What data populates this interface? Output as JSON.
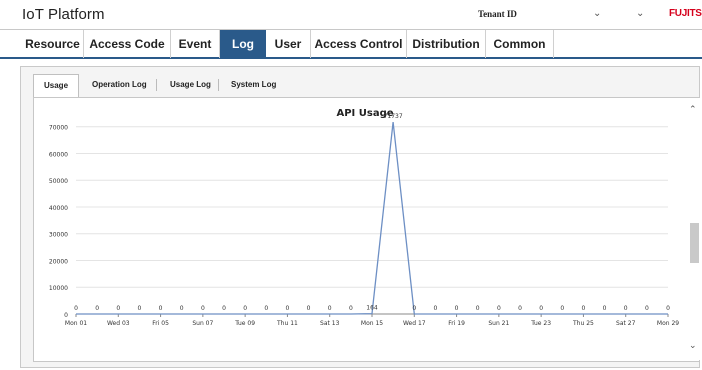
{
  "header": {
    "app_title": "IoT Platform",
    "tenant_label": "Tenant ID",
    "tenant_dropdown_arrow": "⌄",
    "second_dropdown_arrow": "⌄",
    "brand": "FUJITSU"
  },
  "nav": {
    "tabs": [
      {
        "label": "Resource"
      },
      {
        "label": "Access Code"
      },
      {
        "label": "Event"
      },
      {
        "label": "Log"
      },
      {
        "label": "User"
      },
      {
        "label": "Access Control"
      },
      {
        "label": "Distribution"
      },
      {
        "label": "Common"
      }
    ],
    "active": "Log"
  },
  "subtabs": {
    "tabs": [
      {
        "label": "Usage"
      },
      {
        "label": "Operation Log"
      },
      {
        "label": "Usage Log"
      },
      {
        "label": "System Log"
      }
    ],
    "active": "Usage"
  },
  "scrollbar": {
    "up_arrow": "⌃",
    "down_arrow": "⌄"
  },
  "chart_data": {
    "type": "line",
    "title": "API Usage",
    "xlabel": "",
    "ylabel": "",
    "ylim": [
      0,
      77000
    ],
    "yticks": [
      0,
      10000,
      20000,
      30000,
      40000,
      50000,
      60000,
      70000
    ],
    "x_tick_labels": [
      "Mon 01",
      "Wed 03",
      "Fri 05",
      "Sun 07",
      "Tue 09",
      "Thu 11",
      "Sat 13",
      "Mon 15",
      "Wed 17",
      "Fri 19",
      "Sun 21",
      "Tue 23",
      "Thu 25",
      "Sat 27",
      "Mon 29"
    ],
    "days": [
      1,
      2,
      3,
      4,
      5,
      6,
      7,
      8,
      9,
      10,
      11,
      12,
      13,
      14,
      15,
      16,
      17,
      18,
      19,
      20,
      21,
      22,
      23,
      24,
      25,
      26,
      27,
      28,
      29
    ],
    "values": [
      0,
      0,
      0,
      0,
      0,
      0,
      0,
      0,
      0,
      0,
      0,
      0,
      0,
      0,
      164,
      71737,
      0,
      0,
      0,
      0,
      0,
      0,
      0,
      0,
      0,
      0,
      0,
      0,
      0
    ],
    "line_color": "#6d8fc4",
    "grid": true
  }
}
